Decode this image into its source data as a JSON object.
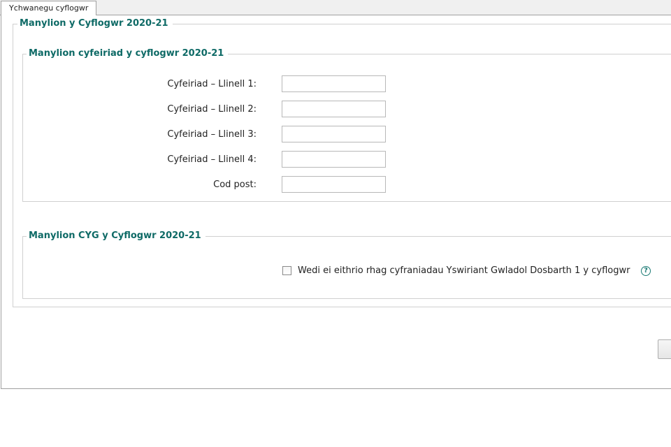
{
  "tabs": [
    {
      "label": "Ychwanegu cyflogwr",
      "active": true
    }
  ],
  "sections": {
    "employer_details": {
      "title": "Manylion y Cyflogwr 2020-21"
    },
    "address": {
      "title": "Manylion cyfeiriad y cyflogwr 2020-21",
      "fields": [
        {
          "label": "Cyfeiriad – Llinell 1:",
          "value": ""
        },
        {
          "label": "Cyfeiriad – Llinell 2:",
          "value": ""
        },
        {
          "label": "Cyfeiriad – Llinell 3:",
          "value": ""
        },
        {
          "label": "Cyfeiriad – Llinell 4:",
          "value": ""
        },
        {
          "label": "Cod post:",
          "value": ""
        }
      ]
    },
    "nic": {
      "title": "Manylion CYG y Cyflogwr 2020-21",
      "checkbox_label": "Wedi ei eithrio rhag cyfraniadau Yswiriant Gwladol Dosbarth 1 y cyflogwr",
      "checked": false,
      "help_glyph": "?"
    }
  },
  "icons": {
    "help": "question-circle-icon"
  },
  "colors": {
    "section_title": "#0e6a66",
    "help_icon": "#1a7a74",
    "border": "#d0d0d0"
  }
}
